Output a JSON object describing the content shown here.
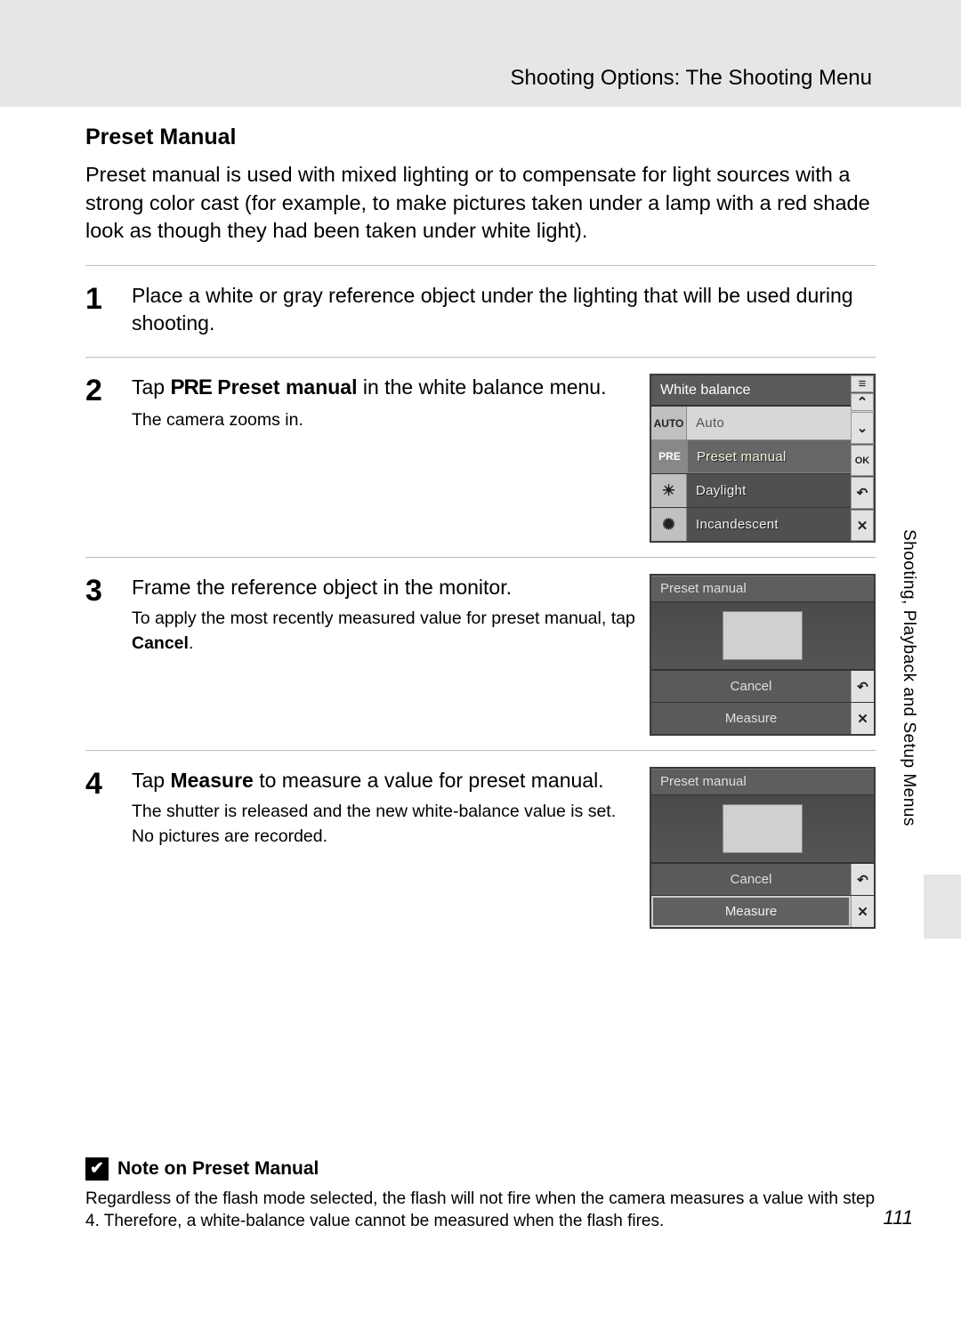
{
  "header": {
    "title": "Shooting Options: The Shooting Menu"
  },
  "section": {
    "title": "Preset Manual",
    "intro": "Preset manual is used with mixed lighting or to compensate for light sources with a strong color cast (for example, to make pictures taken under a lamp with a red shade look as though they had been taken under white light)."
  },
  "steps": [
    {
      "num": "1",
      "head": "Place a white or gray reference object under the lighting that will be used during shooting."
    },
    {
      "num": "2",
      "head_pre": "Tap ",
      "pre_glyph": "PRE",
      "head_mid_strong": " Preset manual",
      "head_post": " in the white balance menu.",
      "sub": "The camera zooms in."
    },
    {
      "num": "3",
      "head": "Frame the reference object in the monitor.",
      "sub_pre": "To apply the most recently measured value for preset manual, tap ",
      "sub_strong": "Cancel",
      "sub_post": "."
    },
    {
      "num": "4",
      "head_pre": "Tap ",
      "head_strong": "Measure",
      "head_post": " to measure a value for preset manual.",
      "sub1": "The shutter is released and the new white-balance value is set.",
      "sub2": "No pictures are recorded."
    }
  ],
  "wb_menu": {
    "title": "White balance",
    "rows": [
      {
        "icon": "AUTO",
        "label": "Auto"
      },
      {
        "icon": "PRE",
        "label": "Preset manual"
      },
      {
        "icon": "sun",
        "label": "Daylight"
      },
      {
        "icon": "bulb",
        "label": "Incandescent"
      }
    ],
    "side": {
      "up": "⌃",
      "down": "⌄",
      "ok": "OK",
      "back": "↶",
      "close": "✕",
      "list": "≡"
    }
  },
  "pm_panel": {
    "title": "Preset manual",
    "cancel": "Cancel",
    "measure": "Measure",
    "back": "↶",
    "close": "✕"
  },
  "side_tab": "Shooting, Playback and Setup Menus",
  "note": {
    "icon": "✔",
    "title": "Note on Preset Manual",
    "body": "Regardless of the flash mode selected, the flash will not fire when the camera measures a value with step 4. Therefore, a white-balance value cannot be measured when the flash fires."
  },
  "page_number": "111"
}
